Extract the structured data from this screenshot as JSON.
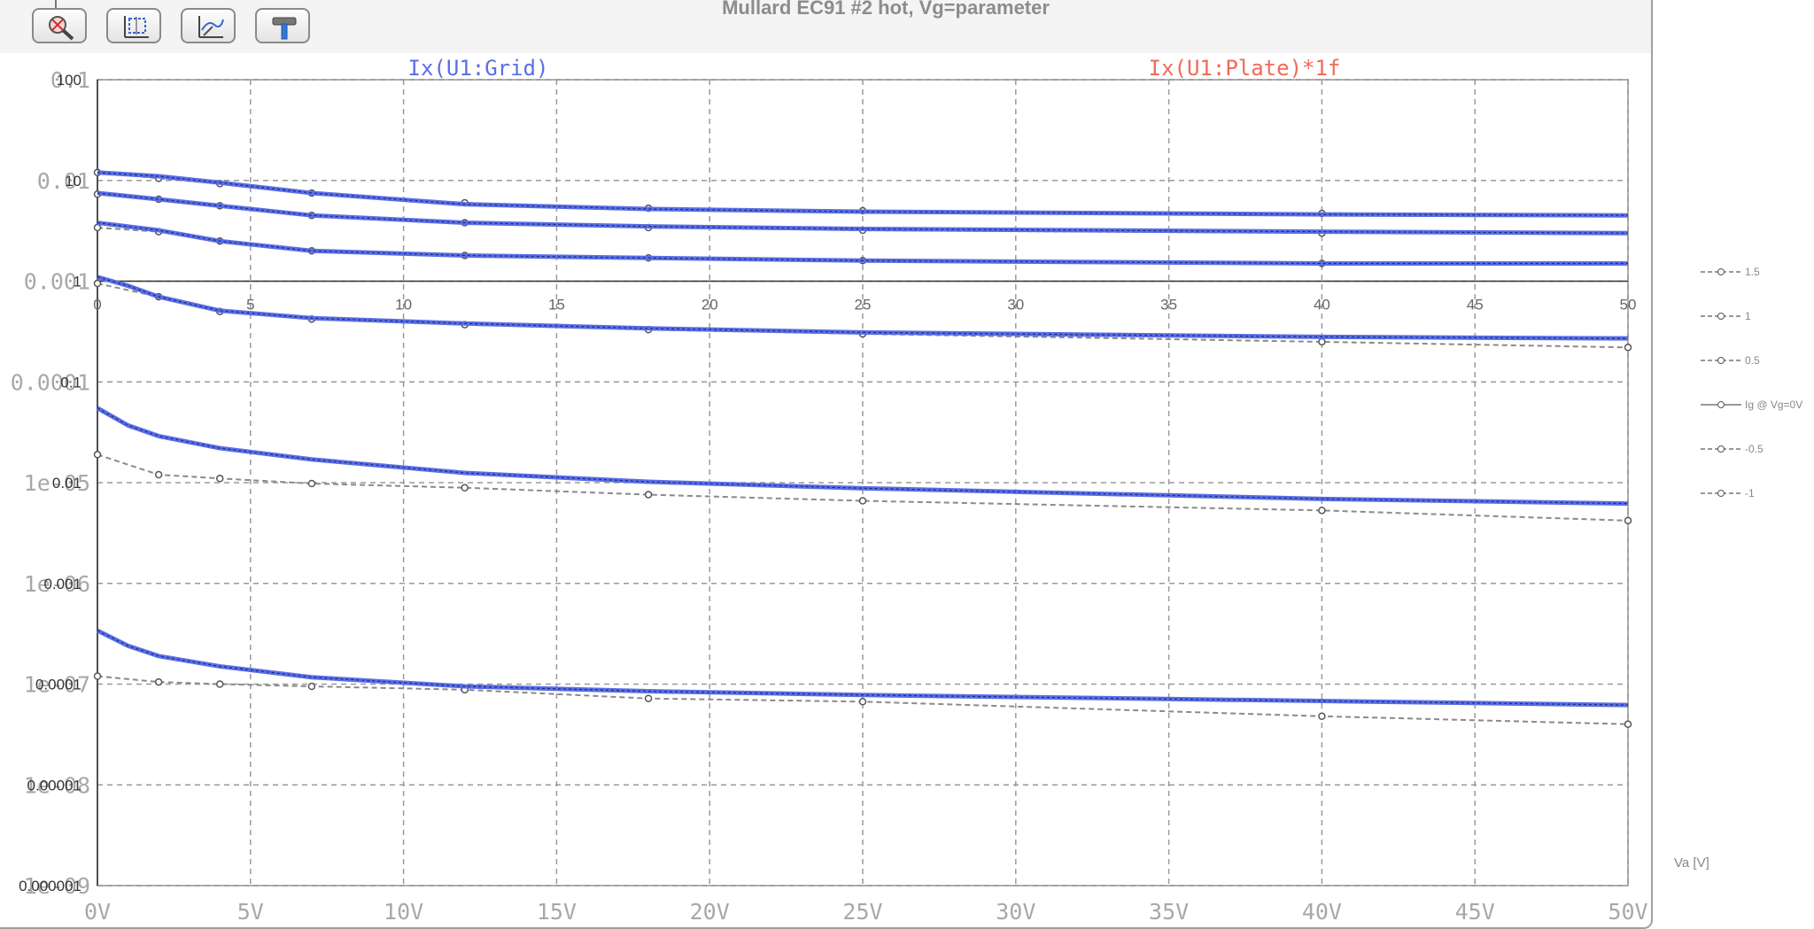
{
  "toolbar": {
    "buttons": [
      {
        "name": "zoom-to-fit",
        "icon": "zoom-cancel-icon"
      },
      {
        "name": "autorange",
        "icon": "autorange-icon"
      },
      {
        "name": "trace-cursor",
        "icon": "trace-cursor-icon"
      },
      {
        "name": "settings",
        "icon": "hammer-icon"
      }
    ]
  },
  "chart_data": {
    "type": "line",
    "title": "Mullard EC91 #2 hot, Vg=parameter",
    "trace_labels": [
      {
        "label": "Ix(U1:Grid)",
        "color": "#5a6ee6"
      },
      {
        "label": "Ix(U1:Plate)*1f",
        "color": "#f06a5a"
      }
    ],
    "x_axis": {
      "ticks": [
        "0V",
        "5V",
        "10V",
        "15V",
        "20V",
        "25V",
        "30V",
        "35V",
        "40V",
        "45V",
        "50V"
      ],
      "range": [
        0,
        50
      ],
      "unit": "V"
    },
    "y_axis_sim": {
      "ticks": [
        "0.1",
        "0.01",
        "0.001",
        "0.0001",
        "1e-05",
        "1e-06",
        "1e-07",
        "1e-08",
        "1e-09"
      ],
      "scale": "log"
    },
    "y_axis_meas": {
      "ticks": [
        "100",
        "10",
        "1",
        "0.1",
        "0.01",
        "0.001",
        "0.0001",
        "0.00001",
        "0.000001"
      ],
      "scale": "log"
    },
    "x_axis_meas": {
      "ticks": [
        "0",
        "5",
        "10",
        "15",
        "20",
        "25",
        "30",
        "35",
        "40",
        "45",
        "50"
      ]
    },
    "xlabel_meas": "Va [V]",
    "ylim": [
      1e-09,
      0.1
    ],
    "grid": true,
    "legend_placement": "right",
    "simulated_series": [
      {
        "color": "#5a6ee6",
        "x": [
          0,
          2,
          4,
          7,
          12,
          18,
          25,
          40,
          50
        ],
        "y": [
          0.012,
          0.011,
          0.0095,
          0.0075,
          0.0058,
          0.0052,
          0.0049,
          0.0046,
          0.0045
        ]
      },
      {
        "color": "#5a6ee6",
        "x": [
          0,
          2,
          4,
          7,
          12,
          18,
          25,
          40,
          50
        ],
        "y": [
          0.0075,
          0.0065,
          0.0056,
          0.0045,
          0.0038,
          0.0035,
          0.0033,
          0.0031,
          0.003
        ]
      },
      {
        "color": "#5a6ee6",
        "x": [
          0,
          2,
          4,
          7,
          12,
          18,
          25,
          40,
          50
        ],
        "y": [
          0.0038,
          0.0032,
          0.0025,
          0.002,
          0.0018,
          0.0017,
          0.0016,
          0.0015,
          0.0015
        ]
      },
      {
        "color": "#5a6ee6",
        "x": [
          0,
          1,
          2,
          4,
          7,
          12,
          18,
          25,
          40,
          50
        ],
        "y": [
          0.0011,
          0.0009,
          0.0007,
          0.00051,
          0.00043,
          0.00038,
          0.00034,
          0.00031,
          0.00028,
          0.00027
        ]
      },
      {
        "color": "#5a6ee6",
        "x": [
          0,
          1,
          2,
          4,
          7,
          12,
          18,
          25,
          40,
          50
        ],
        "y": [
          5.5e-05,
          3.7e-05,
          2.9e-05,
          2.2e-05,
          1.7e-05,
          1.25e-05,
          1.02e-05,
          8.8e-06,
          6.9e-06,
          6.2e-06
        ]
      },
      {
        "color": "#5a6ee6",
        "x": [
          0,
          1,
          2,
          4,
          7,
          12,
          18,
          25,
          40,
          50
        ],
        "y": [
          3.4e-07,
          2.4e-07,
          1.9e-07,
          1.5e-07,
          1.17e-07,
          9.5e-08,
          8.5e-08,
          7.8e-08,
          6.8e-08,
          6.2e-08
        ]
      }
    ],
    "measured_series": [
      {
        "name": "1.5",
        "x": [
          0,
          2,
          4,
          7,
          12,
          18,
          25,
          40
        ],
        "y": [
          12,
          10.5,
          9.3,
          7.5,
          6,
          5.3,
          5,
          4.7
        ]
      },
      {
        "name": "1",
        "x": [
          0,
          2,
          4,
          7,
          12,
          18,
          25,
          40
        ],
        "y": [
          7.3,
          6.5,
          5.6,
          4.5,
          3.8,
          3.4,
          3.2,
          3
        ]
      },
      {
        "name": "0.5",
        "x": [
          0,
          2,
          4,
          7,
          12,
          18,
          25,
          40
        ],
        "y": [
          3.4,
          3.1,
          2.5,
          2,
          1.8,
          1.7,
          1.6,
          1.5
        ]
      },
      {
        "name": "Ig @ Vg=0V",
        "x": [
          0,
          2,
          4,
          7,
          12,
          18,
          25,
          40,
          50
        ],
        "y": [
          0.95,
          0.7,
          0.5,
          0.42,
          0.37,
          0.33,
          0.3,
          0.25,
          0.22
        ]
      },
      {
        "name": "-0.5",
        "x": [
          0,
          2,
          4,
          7,
          12,
          18,
          25,
          40,
          50
        ],
        "y": [
          0.019,
          0.012,
          0.011,
          0.0098,
          0.0089,
          0.0076,
          0.0066,
          0.0053,
          0.0042
        ]
      },
      {
        "name": "-1",
        "x": [
          0,
          2,
          4,
          7,
          12,
          18,
          25,
          40,
          50
        ],
        "y": [
          0.00012,
          0.000105,
          0.0001,
          9.5e-05,
          8.8e-05,
          7.2e-05,
          6.7e-05,
          4.8e-05,
          4e-05
        ]
      }
    ]
  }
}
